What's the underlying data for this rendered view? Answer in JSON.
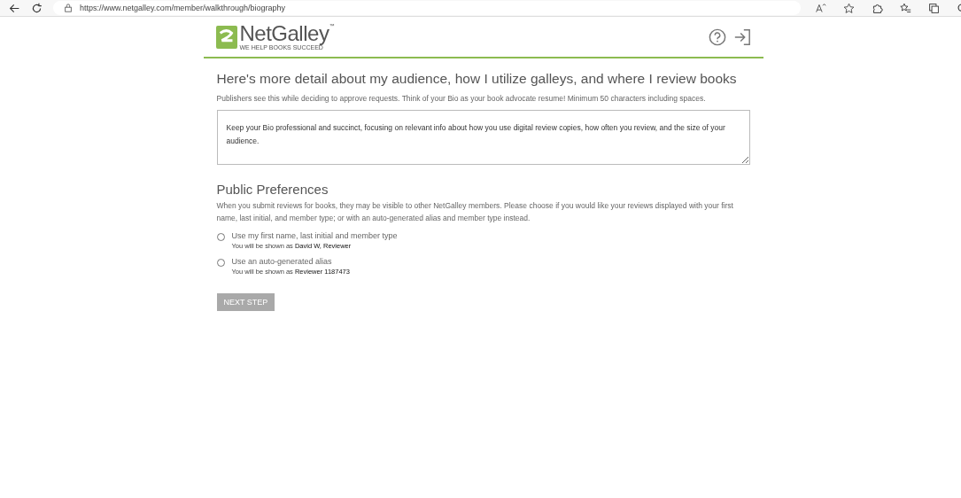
{
  "browser": {
    "url": "https://www.netgalley.com/member/walkthrough/biography"
  },
  "logo": {
    "name": "NetGalley",
    "trademark": "™",
    "tagline": "WE HELP BOOKS SUCCEED"
  },
  "bio": {
    "heading": "Here's more detail about my audience, how I utilize galleys, and where I review books",
    "description": "Publishers see this while deciding to approve requests. Think of your Bio as your book advocate resume! Minimum 50 characters including spaces.",
    "placeholder": "Keep your Bio professional and succinct, focusing on relevant info about how you use digital review copies, how often you review, and the size of your audience."
  },
  "preferences": {
    "heading": "Public Preferences",
    "description": "When you submit reviews for books, they may be visible to other NetGalley members. Please choose if you would like your reviews displayed with your first name, last initial, and member type; or with an auto-generated alias and member type instead.",
    "options": [
      {
        "label": "Use my first name, last initial and member type",
        "hint": "You will be shown as",
        "shown_as": "David W, Reviewer",
        "selected": false
      },
      {
        "label": "Use an auto-generated alias",
        "hint": "You will be shown as",
        "shown_as": "Reviewer 1187473",
        "selected": false
      }
    ]
  },
  "next_button": {
    "label": "NEXT STEP",
    "disabled": true
  }
}
